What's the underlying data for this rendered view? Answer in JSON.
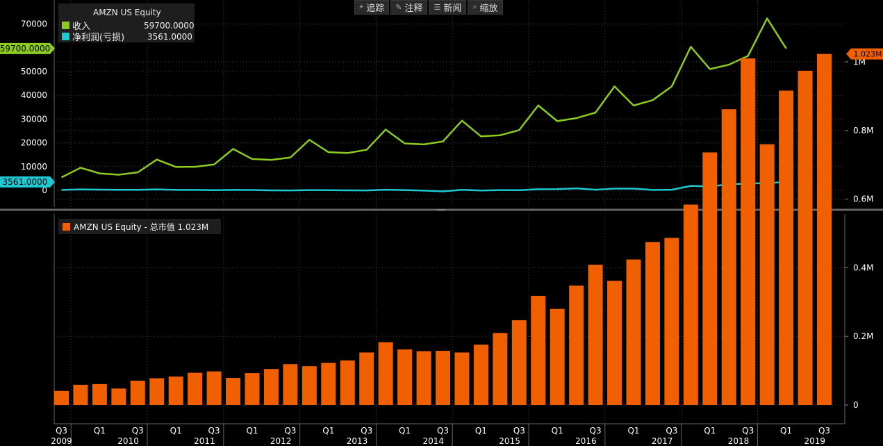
{
  "toolbar": {
    "buttons": [
      {
        "icon": "crosshair-icon",
        "glyph": "⌖",
        "label": "追踪"
      },
      {
        "icon": "pencil-icon",
        "glyph": "✎",
        "label": "注释"
      },
      {
        "icon": "news-icon",
        "glyph": "☰",
        "label": "新闻"
      },
      {
        "icon": "zoom-icon",
        "glyph": "⌕",
        "label": "缩放"
      }
    ]
  },
  "legend_top": {
    "title": "AMZN US Equity",
    "rows": [
      {
        "label": "收入",
        "value": "59700.0000"
      },
      {
        "label": "净利润(亏损)",
        "value": "3561.0000"
      }
    ]
  },
  "legend_bottom": {
    "label": "AMZN US Equity - 总市值 1.023M"
  },
  "chart_data": [
    {
      "type": "line",
      "colors": {
        "revenue": "#8ccc1e",
        "net_income": "#1ec8d0",
        "grid": "#444444"
      },
      "y_ticks": [
        0,
        10000,
        20000,
        30000,
        40000,
        50000,
        70000
      ],
      "ylim": [
        -5000,
        78000
      ],
      "markers": [
        {
          "label": "59700.0000",
          "value": 59700,
          "color": "#8ccc1e"
        },
        {
          "label": "3561.0000",
          "value": 3561,
          "color": "#1ec8d0"
        }
      ],
      "series": [
        {
          "name": "收入",
          "values": [
            5450,
            9520,
            7130,
            6570,
            7560,
            12950,
            9860,
            9910,
            10880,
            17430,
            13180,
            12830,
            13810,
            21270,
            16070,
            15700,
            17090,
            25590,
            19740,
            19340,
            20580,
            29330,
            22720,
            23190,
            25360,
            35750,
            29130,
            30400,
            32710,
            43740,
            35710,
            37960,
            43740,
            60450,
            51040,
            52890,
            56580,
            72380,
            59700
          ]
        },
        {
          "name": "净利润(亏损)",
          "values": [
            199,
            384,
            299,
            207,
            231,
            416,
            201,
            191,
            63,
            177,
            130,
            7,
            -41,
            97,
            82,
            7,
            -41,
            239,
            108,
            -126,
            -437,
            214,
            -57,
            92,
            79,
            482,
            513,
            857,
            252,
            749,
            724,
            197,
            256,
            1856,
            1629,
            2534,
            2883,
            3027,
            3561
          ]
        }
      ]
    },
    {
      "type": "bar",
      "color": "#f06000",
      "y_ticks": [
        "0",
        "0.2M",
        "0.4M",
        "0.6M",
        "0.8M",
        "1M"
      ],
      "ylim": [
        0,
        1.1
      ],
      "marker": {
        "label": "1.023M",
        "value": 1.023
      },
      "values": [
        0.041,
        0.059,
        0.061,
        0.048,
        0.071,
        0.078,
        0.083,
        0.094,
        0.098,
        0.079,
        0.093,
        0.105,
        0.119,
        0.113,
        0.123,
        0.13,
        0.153,
        0.183,
        0.162,
        0.157,
        0.158,
        0.153,
        0.176,
        0.21,
        0.247,
        0.318,
        0.28,
        0.348,
        0.409,
        0.362,
        0.424,
        0.475,
        0.487,
        0.584,
        0.736,
        0.862,
        1.01,
        0.76,
        0.916,
        0.974,
        1.023
      ]
    }
  ],
  "x_axis": {
    "quarter_labels": [
      "Q3",
      "Q1",
      "Q3",
      "Q1",
      "Q3",
      "Q1",
      "Q3",
      "Q1",
      "Q3",
      "Q1",
      "Q3",
      "Q1",
      "Q3",
      "Q1",
      "Q3",
      "Q1",
      "Q3",
      "Q1",
      "Q3",
      "Q1",
      "Q3"
    ],
    "year_labels": [
      "2009",
      "2010",
      "2011",
      "2012",
      "2013",
      "2014",
      "2015",
      "2016",
      "2017",
      "2018",
      "2019"
    ]
  }
}
